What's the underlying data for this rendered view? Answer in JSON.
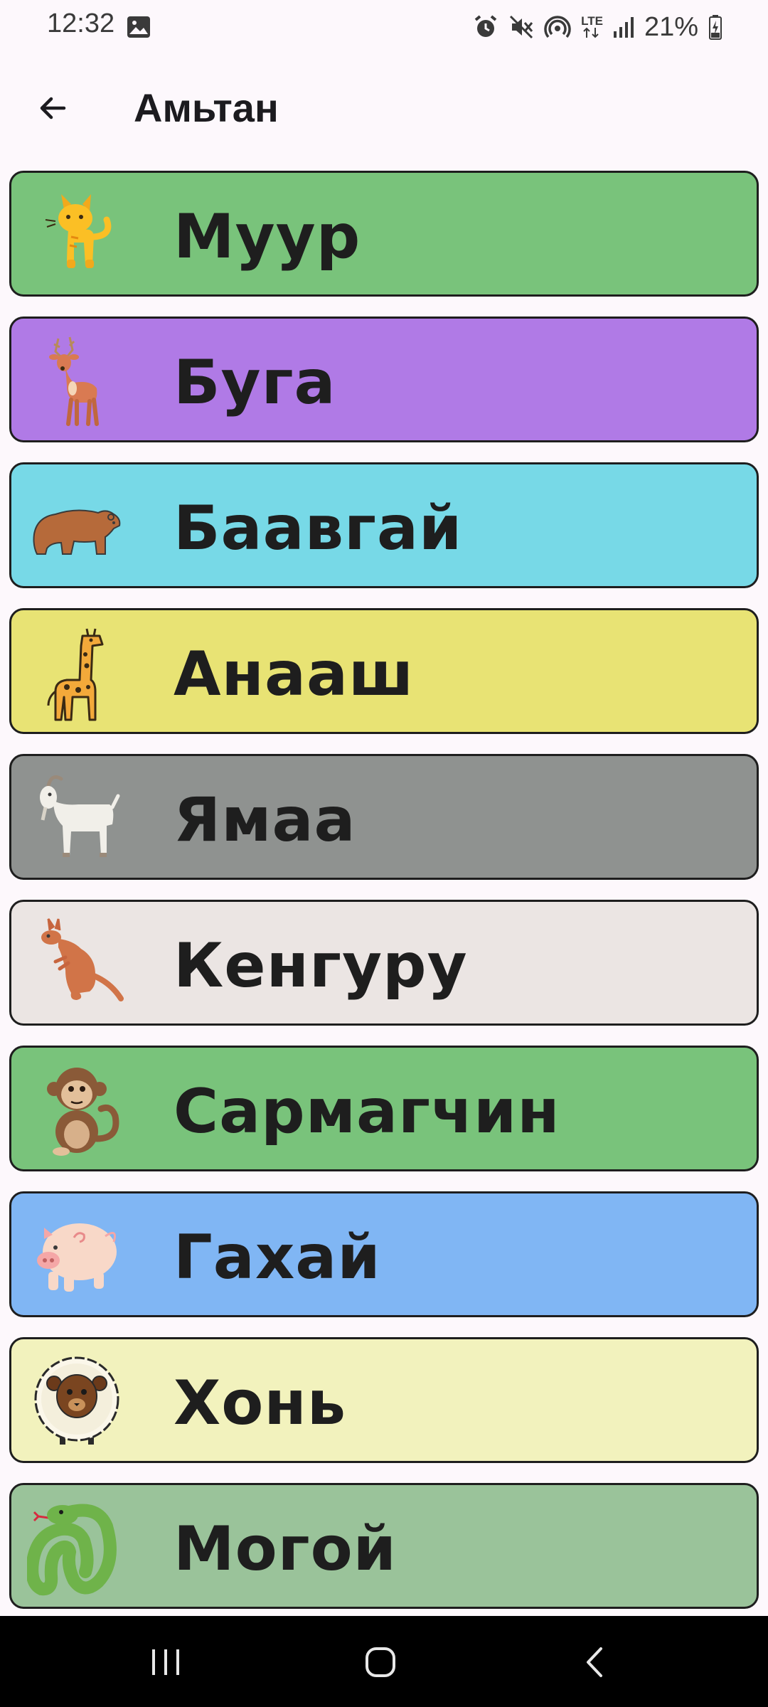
{
  "status_bar": {
    "time": "12:32",
    "network": "LTE",
    "battery": "21%"
  },
  "app_bar": {
    "title": "Амьтан"
  },
  "animals": [
    {
      "name": "Муур",
      "icon": "cat-icon",
      "color": "#79c37b"
    },
    {
      "name": "Буга",
      "icon": "deer-icon",
      "color": "#b07ae6"
    },
    {
      "name": "Баавгай",
      "icon": "bear-icon",
      "color": "#77d9e7"
    },
    {
      "name": "Анааш",
      "icon": "giraffe-icon",
      "color": "#e8e374"
    },
    {
      "name": "Ямаа",
      "icon": "goat-icon",
      "color": "#8f9290"
    },
    {
      "name": "Кенгуру",
      "icon": "kangaroo-icon",
      "color": "#ebe5e3"
    },
    {
      "name": "Сармагчин",
      "icon": "monkey-icon",
      "color": "#79c37b"
    },
    {
      "name": "Гахай",
      "icon": "pig-icon",
      "color": "#80b6f4"
    },
    {
      "name": "Хонь",
      "icon": "sheep-icon",
      "color": "#f2f2bd"
    },
    {
      "name": "Могой",
      "icon": "snake-icon",
      "color": "#9ac39a"
    }
  ],
  "nav_bar": {
    "recents": "recents-icon",
    "home": "home-icon",
    "back": "back-icon"
  }
}
